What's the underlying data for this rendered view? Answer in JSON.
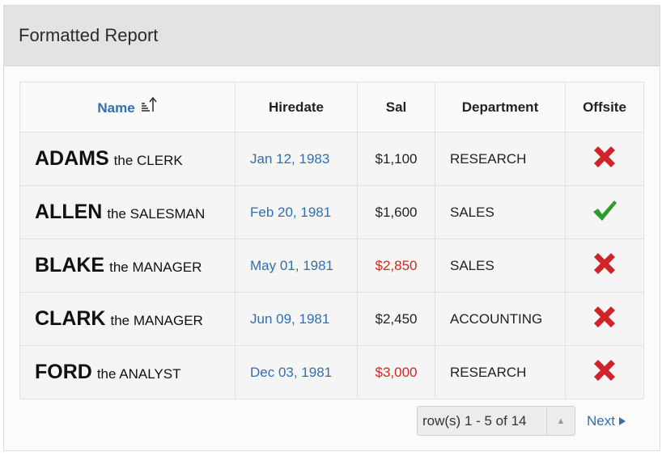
{
  "region": {
    "title": "Formatted Report"
  },
  "columns": {
    "name": "Name",
    "hiredate": "Hiredate",
    "sal": "Sal",
    "department": "Department",
    "offsite": "Offsite"
  },
  "rows": [
    {
      "ename": "ADAMS",
      "job": "the CLERK",
      "hiredate": "Jan 12, 1983",
      "sal": "$1,100",
      "department": "RESEARCH",
      "offsite": "no"
    },
    {
      "ename": "ALLEN",
      "job": "the SALESMAN",
      "hiredate": "Feb 20, 1981",
      "sal": "$1,600",
      "department": "SALES",
      "offsite": "yes"
    },
    {
      "ename": "BLAKE",
      "job": "the MANAGER",
      "hiredate": "May 01, 1981",
      "sal": "$2,850",
      "department": "SALES",
      "offsite": "no"
    },
    {
      "ename": "CLARK",
      "job": "the MANAGER",
      "hiredate": "Jun 09, 1981",
      "sal": "$2,450",
      "department": "ACCOUNTING",
      "offsite": "no"
    },
    {
      "ename": "FORD",
      "job": "the ANALYST",
      "hiredate": "Dec 03, 1981",
      "sal": "$3,000",
      "department": "RESEARCH",
      "offsite": "no"
    }
  ],
  "pagination": {
    "range_label": "row(s) 1 - 5 of 14",
    "next_label": "Next"
  },
  "colors": {
    "link": "#2f6fb5",
    "high_salary": "#d8261e",
    "check": "#2e9a2e",
    "cross": "#d0242a"
  }
}
